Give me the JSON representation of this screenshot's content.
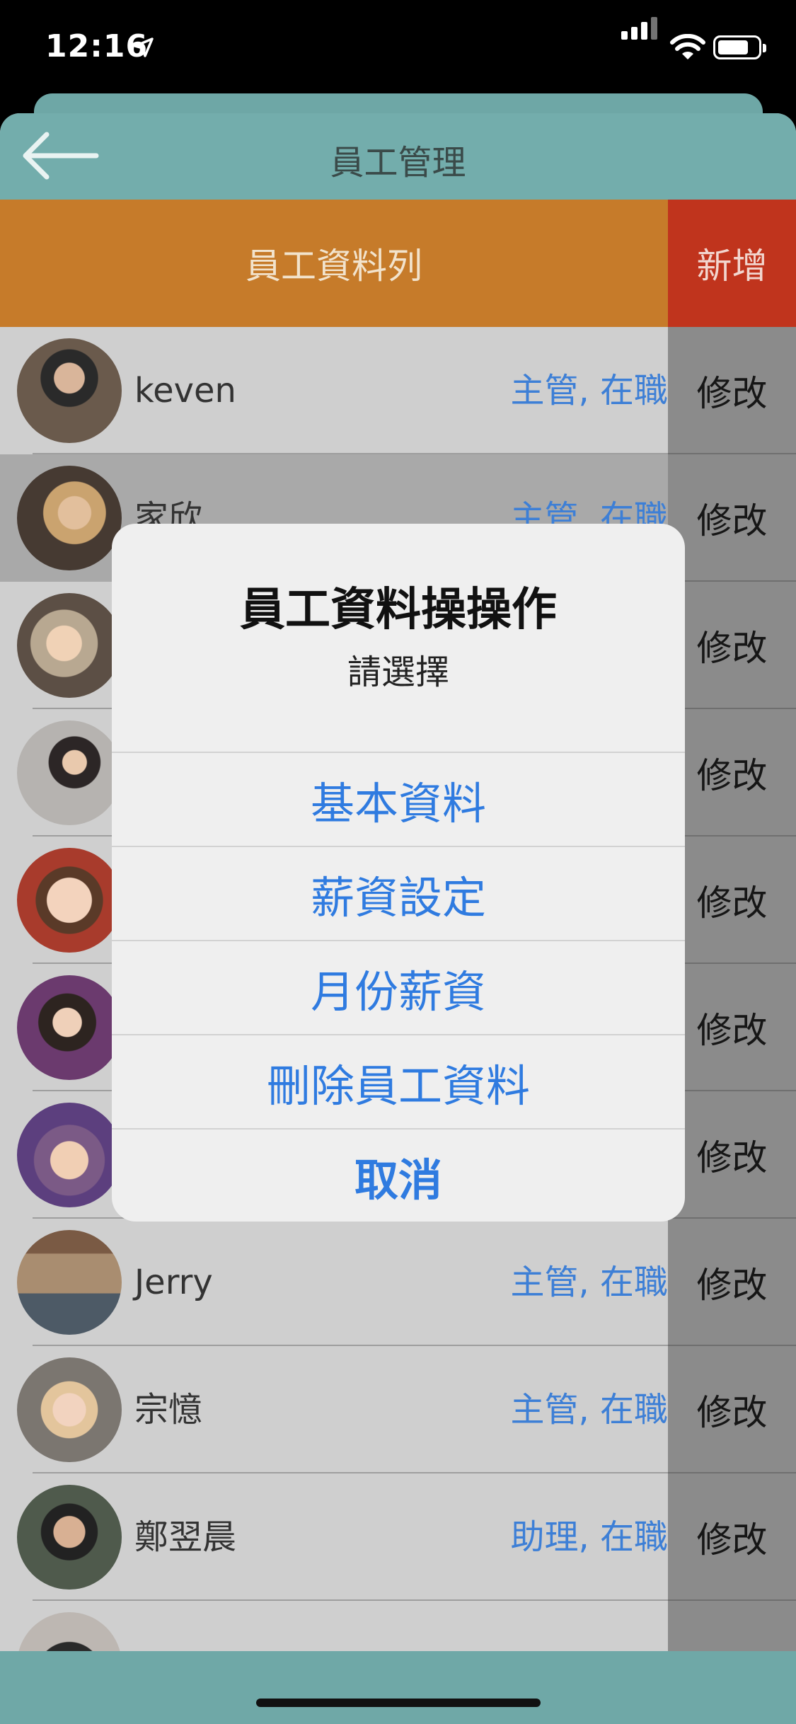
{
  "status_bar": {
    "time": "12:16"
  },
  "nav": {
    "title": "員工管理"
  },
  "header": {
    "title": "員工資料列",
    "add_label": "新增"
  },
  "employees": [
    {
      "name": "keven",
      "role": "主管, 在職",
      "edit": "修改"
    },
    {
      "name": "家欣",
      "role": "主管, 在職",
      "edit": "修改"
    },
    {
      "name": "",
      "role": "",
      "edit": "修改"
    },
    {
      "name": "",
      "role": "",
      "edit": "修改"
    },
    {
      "name": "",
      "role": "",
      "edit": "修改"
    },
    {
      "name": "",
      "role": "",
      "edit": "修改"
    },
    {
      "name": "",
      "role": "",
      "edit": "修改"
    },
    {
      "name": "Jerry",
      "role": "主管, 在職",
      "edit": "修改"
    },
    {
      "name": "宗憶",
      "role": "主管, 在職",
      "edit": "修改"
    },
    {
      "name": "鄭翌晨",
      "role": "助理, 在職",
      "edit": "修改"
    }
  ],
  "alert": {
    "title": "員工資料操操作",
    "subtitle": "請選擇",
    "actions": [
      "基本資料",
      "薪資設定",
      "月份薪資",
      "刪除員工資料"
    ],
    "cancel": "取消"
  },
  "colors": {
    "nav": "#73adac",
    "header": "#c67b2a",
    "add_button": "#c0341d",
    "role_text": "#3d7fd6",
    "alert_action": "#2f7be0"
  }
}
